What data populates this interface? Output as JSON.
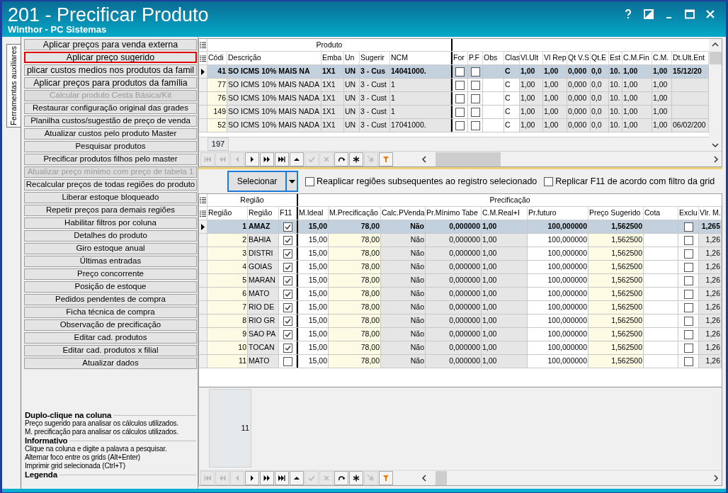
{
  "window": {
    "title": "201 - Precificar Produto",
    "subtitle": "Winthor - PC Sistemas"
  },
  "side_tab": {
    "label": "Ferramentas auxiliares",
    "selected": true
  },
  "tools": [
    {
      "label": "Aplicar preços para venda externa",
      "disabled": false,
      "selected": false
    },
    {
      "label": "Aplicar preço sugerido",
      "disabled": false,
      "selected": true
    },
    {
      "label": "plicar custos medios nos produtos da famil",
      "disabled": false,
      "selected": false
    },
    {
      "label": "Aplicar preços para produtos da família",
      "disabled": false,
      "selected": false
    },
    {
      "label": "Calcular produto Cesta Básica/Kit",
      "disabled": true,
      "selected": false
    },
    {
      "label": "Restaurar configuração original das grades",
      "disabled": false,
      "selected": false
    },
    {
      "label": "Planilha custos/sugestão de preço de venda",
      "disabled": false,
      "selected": false
    },
    {
      "label": "Atualizar custos pelo produto Master",
      "disabled": false,
      "selected": false
    },
    {
      "label": "Pesquisar produtos",
      "disabled": false,
      "selected": false
    },
    {
      "label": "Precificar produtos filhos pelo master",
      "disabled": false,
      "selected": false
    },
    {
      "label": "Atualizar preço mínimo com preço de tabela 1",
      "disabled": true,
      "selected": false
    },
    {
      "label": "Recalcular preços de todas regiões do produto",
      "disabled": false,
      "selected": false
    },
    {
      "label": "Liberar estoque bloqueado",
      "disabled": false,
      "selected": false
    },
    {
      "label": "Repetir preços para demais regiões",
      "disabled": false,
      "selected": false
    },
    {
      "label": "Habilitar filtros por coluna",
      "disabled": false,
      "selected": false
    },
    {
      "label": "Detalhes do produto",
      "disabled": false,
      "selected": false
    },
    {
      "label": "Giro estoque anual",
      "disabled": false,
      "selected": false
    },
    {
      "label": "Últimas entradas",
      "disabled": false,
      "selected": false
    },
    {
      "label": "Preço concorrente",
      "disabled": false,
      "selected": false
    },
    {
      "label": "Posição de estoque",
      "disabled": false,
      "selected": false
    },
    {
      "label": "Pedidos pendentes de compra",
      "disabled": false,
      "selected": false
    },
    {
      "label": "Ficha técnica de compra",
      "disabled": false,
      "selected": false
    },
    {
      "label": "Observação de precificação",
      "disabled": false,
      "selected": false
    },
    {
      "label": "Editar cad. produtos",
      "disabled": false,
      "selected": false
    },
    {
      "label": "Editar cad. produtos x filial",
      "disabled": false,
      "selected": false
    },
    {
      "label": "Atualizar dados",
      "disabled": false,
      "selected": false
    }
  ],
  "help": [
    {
      "heading": "Duplo-clique na coluna",
      "lines": [
        "Preço sugerido para analisar os cálculos utilizados.",
        "M. precificação para analisar os cálculos utilizados."
      ]
    },
    {
      "heading": "Informativo",
      "lines": [
        "Clique na coluna e digite a palavra a pesquisar.",
        "Alternar foco entre os grids (Alt+Enter)",
        "Imprimir grid selecionada (Ctrl+T)"
      ]
    },
    {
      "heading": "Legenda"
    }
  ],
  "product_grid": {
    "group_headers": [
      "Produto"
    ],
    "columns": [
      {
        "label": "Códi",
        "kind": "text"
      },
      {
        "label": "Descrição",
        "kind": "text"
      },
      {
        "label": "Emba",
        "kind": "text"
      },
      {
        "label": "Un",
        "kind": "text"
      },
      {
        "label": "Sugerir",
        "kind": "text"
      },
      {
        "label": "NCM",
        "kind": "text"
      },
      {
        "label": "For",
        "kind": "check"
      },
      {
        "label": "P.F",
        "kind": "check"
      },
      {
        "label": "Obs",
        "kind": "text"
      },
      {
        "label": "Clas",
        "kind": "text"
      },
      {
        "label": "Vl.Ult",
        "kind": "text"
      },
      {
        "label": "Vl Rep",
        "kind": "text"
      },
      {
        "label": "Qt V.S",
        "kind": "text"
      },
      {
        "label": "Qt.E",
        "kind": "text"
      },
      {
        "label": "Est",
        "kind": "text"
      },
      {
        "label": "C.M.Fin",
        "kind": "text"
      },
      {
        "label": "C.M.",
        "kind": "text"
      },
      {
        "label": "Dt.Ult.Ent",
        "kind": "text"
      }
    ],
    "rows": [
      {
        "selected": true,
        "cells": [
          "41",
          "SO ICMS 10% MAIS NA",
          "1X1",
          "UN",
          "3 - Cus",
          "14041000.",
          false,
          false,
          null,
          "C",
          "1,00",
          "1,00",
          "0,000",
          "0,0",
          "10.",
          "1,00",
          "1,00",
          "15/12/20"
        ]
      },
      {
        "selected": false,
        "cells": [
          "77",
          "SO ICMS 10% MAIS NADA",
          "1X1",
          "UN",
          "3 - Cust",
          "1",
          false,
          false,
          null,
          "C",
          "1,00",
          "1,00",
          "0,000",
          "0,0",
          "10.",
          "1,00",
          "1,00",
          null
        ]
      },
      {
        "selected": false,
        "cells": [
          "76",
          "SO ICMS 10% MAIS NADA",
          "1X1",
          "UN",
          "3 - Cust",
          "1",
          false,
          false,
          null,
          "C",
          "1,00",
          "1,00",
          "0,000",
          "0,0",
          "10.",
          "1,00",
          "1,00",
          null
        ]
      },
      {
        "selected": false,
        "cells": [
          "149",
          "SO ICMS 10% MAIS NADA",
          "1X1",
          "UN",
          "3 - Cust",
          "1",
          false,
          false,
          null,
          "C",
          "1,00",
          "1,00",
          "0,000",
          "0,0",
          "10.",
          "1,00",
          "1,00",
          null
        ]
      },
      {
        "selected": false,
        "cells": [
          "52",
          "SO ICMS 10% MAIS NADA",
          "1X1",
          "UN",
          "3 - Cust",
          "17041000.",
          false,
          false,
          null,
          "C",
          "1,00",
          "1,00",
          "0,000",
          "0,0",
          "10.",
          "1,00",
          "1,00",
          "06/02/200"
        ]
      }
    ],
    "record_count": "197",
    "nav": [
      {
        "kind": "first",
        "disabled": true
      },
      {
        "kind": "prev_page",
        "disabled": true
      },
      {
        "kind": "prev",
        "disabled": true
      },
      {
        "kind": "next",
        "disabled": false
      },
      {
        "kind": "next_page",
        "disabled": false
      },
      {
        "kind": "last",
        "disabled": false
      },
      {
        "kind": "up",
        "disabled": false
      },
      {
        "kind": "post",
        "disabled": true
      },
      {
        "kind": "cancel",
        "disabled": true
      },
      {
        "kind": "refresh",
        "disabled": false
      },
      {
        "kind": "star",
        "disabled": false
      },
      {
        "kind": "star_all",
        "disabled": true
      },
      {
        "kind": "filter",
        "disabled": false
      }
    ]
  },
  "toolbar": {
    "button": "Selecionar",
    "options": [
      {
        "label": "Reaplicar regiões subsequentes ao registro selecionado",
        "checked": false
      },
      {
        "label": "Replicar F11 de acordo com filtro da grid",
        "checked": false
      }
    ]
  },
  "region_grid": {
    "group_headers": [
      "Região",
      "Precificação"
    ],
    "columns": [
      {
        "label": "Região",
        "kind": "text"
      },
      {
        "label": "Região",
        "kind": "text"
      },
      {
        "label": "F11",
        "kind": "check"
      },
      {
        "label": "M.Ideal",
        "kind": "text"
      },
      {
        "label": "M.Precificação",
        "kind": "text"
      },
      {
        "label": "Calc.PVenda",
        "kind": "text"
      },
      {
        "label": "Pr.Mínimo Tabe",
        "kind": "text"
      },
      {
        "label": "C.M.Real+I",
        "kind": "text"
      },
      {
        "label": "Pr.futuro",
        "kind": "text"
      },
      {
        "label": "Preço Sugerido",
        "kind": "text"
      },
      {
        "label": "Cota",
        "kind": "text"
      },
      {
        "label": "Exclu",
        "kind": "check"
      },
      {
        "label": "Vlr. M.",
        "kind": "text"
      }
    ],
    "rows": [
      {
        "selected": true,
        "cells": [
          "1",
          "AMAZ",
          true,
          "15,00",
          "78,00",
          "Não",
          "0,000000",
          "1,00",
          "100,000000",
          "1,562500",
          null,
          false,
          "1,265"
        ]
      },
      {
        "selected": false,
        "cells": [
          "2",
          "BAHIA",
          true,
          "15,00",
          "78,00",
          "Não",
          "0,000000",
          "1,00",
          "100,000000",
          "1,562500",
          null,
          false,
          "1,26"
        ]
      },
      {
        "selected": false,
        "cells": [
          "3",
          "DISTRI",
          true,
          "15,00",
          "78,00",
          "Não",
          "0,000000",
          "1,00",
          "100,000000",
          "1,562500",
          null,
          false,
          "1,26"
        ]
      },
      {
        "selected": false,
        "cells": [
          "4",
          "GOIAS",
          true,
          "15,00",
          "78,00",
          "Não",
          "0,000000",
          "1,00",
          "100,000000",
          "1,562500",
          null,
          false,
          "1,26"
        ]
      },
      {
        "selected": false,
        "cells": [
          "5",
          "MARAN",
          true,
          "15,00",
          "78,00",
          "Não",
          "0,000000",
          "1,00",
          "100,000000",
          "1,562500",
          null,
          false,
          "1,26"
        ]
      },
      {
        "selected": false,
        "cells": [
          "6",
          "MATO",
          true,
          "15,00",
          "78,00",
          "Não",
          "0,000000",
          "1,00",
          "100,000000",
          "1,562500",
          null,
          false,
          "1,26"
        ]
      },
      {
        "selected": false,
        "cells": [
          "7",
          "RIO DE",
          true,
          "15,00",
          "78,00",
          "Não",
          "0,000000",
          "1,00",
          "100,000000",
          "1,562500",
          null,
          false,
          "1,26"
        ]
      },
      {
        "selected": false,
        "cells": [
          "8",
          "RIO GR",
          true,
          "15,00",
          "78,00",
          "Não",
          "0,000000",
          "1,00",
          "100,000000",
          "1,562500",
          null,
          false,
          "1,26"
        ]
      },
      {
        "selected": false,
        "cells": [
          "9",
          "SAO PA",
          true,
          "15,00",
          "78,00",
          "Não",
          "0,000000",
          "1,00",
          "100,000000",
          "1,562500",
          null,
          false,
          "1,26"
        ]
      },
      {
        "selected": false,
        "cells": [
          "10",
          "TOCAN",
          true,
          "15,00",
          "78,00",
          "Não",
          "0,000000",
          "1,00",
          "100,000000",
          "1,562500",
          null,
          false,
          "1,26"
        ]
      },
      {
        "selected": false,
        "cells": [
          "11",
          "MATO",
          false,
          "15,00",
          "78,00",
          "Não",
          "0,000000",
          "1,00",
          "100,000000",
          "1,562500",
          null,
          false,
          "1,26"
        ]
      }
    ],
    "record_count": "11",
    "nav": [
      {
        "kind": "first",
        "disabled": true
      },
      {
        "kind": "prev_page",
        "disabled": true
      },
      {
        "kind": "prev",
        "disabled": true
      },
      {
        "kind": "next",
        "disabled": false
      },
      {
        "kind": "next_page",
        "disabled": false
      },
      {
        "kind": "last",
        "disabled": false
      },
      {
        "kind": "up",
        "disabled": false
      },
      {
        "kind": "post",
        "disabled": true
      },
      {
        "kind": "cancel",
        "disabled": true
      },
      {
        "kind": "refresh",
        "disabled": false
      },
      {
        "kind": "star",
        "disabled": false
      },
      {
        "kind": "star_all",
        "disabled": true
      },
      {
        "kind": "filter",
        "disabled": false
      }
    ]
  }
}
